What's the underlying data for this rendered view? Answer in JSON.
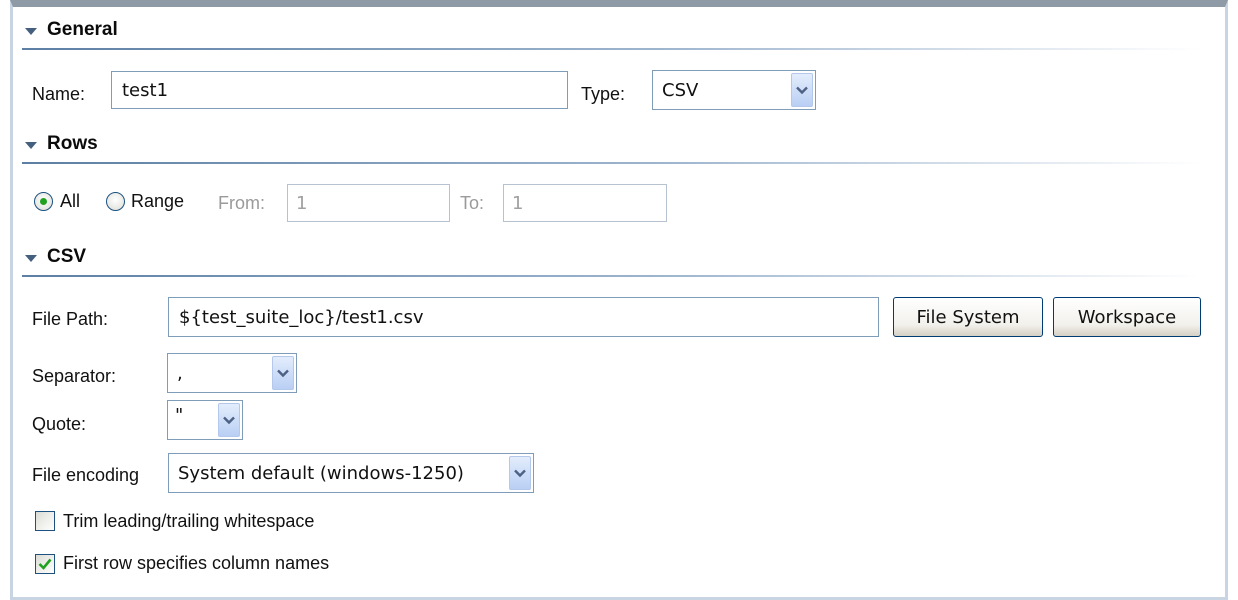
{
  "general": {
    "title": "General",
    "name_label": "Name:",
    "name_value": "test1",
    "type_label": "Type:",
    "type_value": "CSV"
  },
  "rows": {
    "title": "Rows",
    "all_label": "All",
    "range_label": "Range",
    "selected": "All",
    "from_label": "From:",
    "from_value": "1",
    "to_label": "To:",
    "to_value": "1"
  },
  "csv": {
    "title": "CSV",
    "file_path_label": "File Path:",
    "file_path_value": "${test_suite_loc}/test1.csv",
    "file_system_button": "File System",
    "workspace_button": "Workspace",
    "separator_label": "Separator:",
    "separator_value": ",",
    "quote_label": "Quote:",
    "quote_value": "\"",
    "encoding_label": "File encoding",
    "encoding_value": "System default (windows-1250)",
    "trim_label": "Trim leading/trailing whitespace",
    "trim_checked": false,
    "first_row_label": "First row specifies column names",
    "first_row_checked": true
  },
  "colors": {
    "section_rule": "#5d7fa4",
    "radio_dot": "#21a121",
    "check_mark": "#21a121",
    "control_border": "#7f9db9"
  }
}
